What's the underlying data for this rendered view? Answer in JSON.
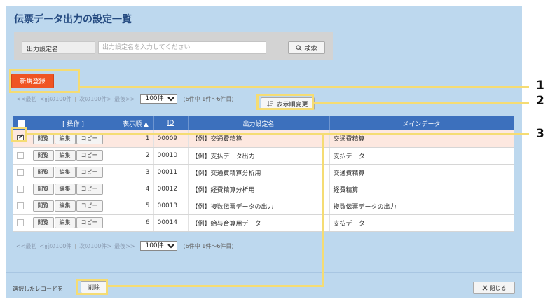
{
  "page": {
    "title": "伝票データ出力の設定一覧"
  },
  "search": {
    "label": "出力設定名",
    "placeholder": "出力設定名を入力してください",
    "button_label": "検索",
    "button_icon": "search-icon"
  },
  "actions": {
    "new_label": "新規登録",
    "sort_label": "表示順変更",
    "sort_icon": "sort-icon"
  },
  "pager": {
    "first": "<<最初",
    "prev": "<前の100件",
    "sep": "|",
    "next": "次の100件>",
    "last": "最後>>",
    "per_page": "100件",
    "count": "(6件中 1件〜6件目)"
  },
  "table": {
    "headers": {
      "ops": "[ 操作 ]",
      "order": "表示順 ▲",
      "id": "ID",
      "name": "出力設定名",
      "main_data": "メインデータ"
    },
    "button_labels": {
      "view": "閲覧",
      "edit": "編集",
      "copy": "コピー"
    },
    "rows": [
      {
        "order": "1",
        "id": "00009",
        "name": "【例】交通費精算",
        "main_data": "交通費精算",
        "checked": true
      },
      {
        "order": "2",
        "id": "00010",
        "name": "【例】支払データ出力",
        "main_data": "支払データ",
        "checked": false
      },
      {
        "order": "3",
        "id": "00011",
        "name": "【例】交通費精算分析用",
        "main_data": "交通費精算",
        "checked": false
      },
      {
        "order": "4",
        "id": "00012",
        "name": "【例】経費精算分析用",
        "main_data": "経費精算",
        "checked": false
      },
      {
        "order": "5",
        "id": "00013",
        "name": "【例】複数伝票データの出力",
        "main_data": "複数伝票データの出力",
        "checked": false
      },
      {
        "order": "6",
        "id": "00014",
        "name": "【例】給与合算用データ",
        "main_data": "支払データ",
        "checked": false
      }
    ]
  },
  "footer": {
    "selected_label": "選択したレコードを",
    "delete_label": "削除",
    "close_label": "閉じる",
    "close_icon": "close-icon"
  },
  "annotations": {
    "one": "1",
    "two": "2",
    "three": "3"
  },
  "colors": {
    "accent_orange": "#ef5423",
    "header_blue": "#3c70bd",
    "panel_blue": "#bdd8ee",
    "highlight_yellow": "#f5dc73",
    "title_blue": "#244a80"
  }
}
